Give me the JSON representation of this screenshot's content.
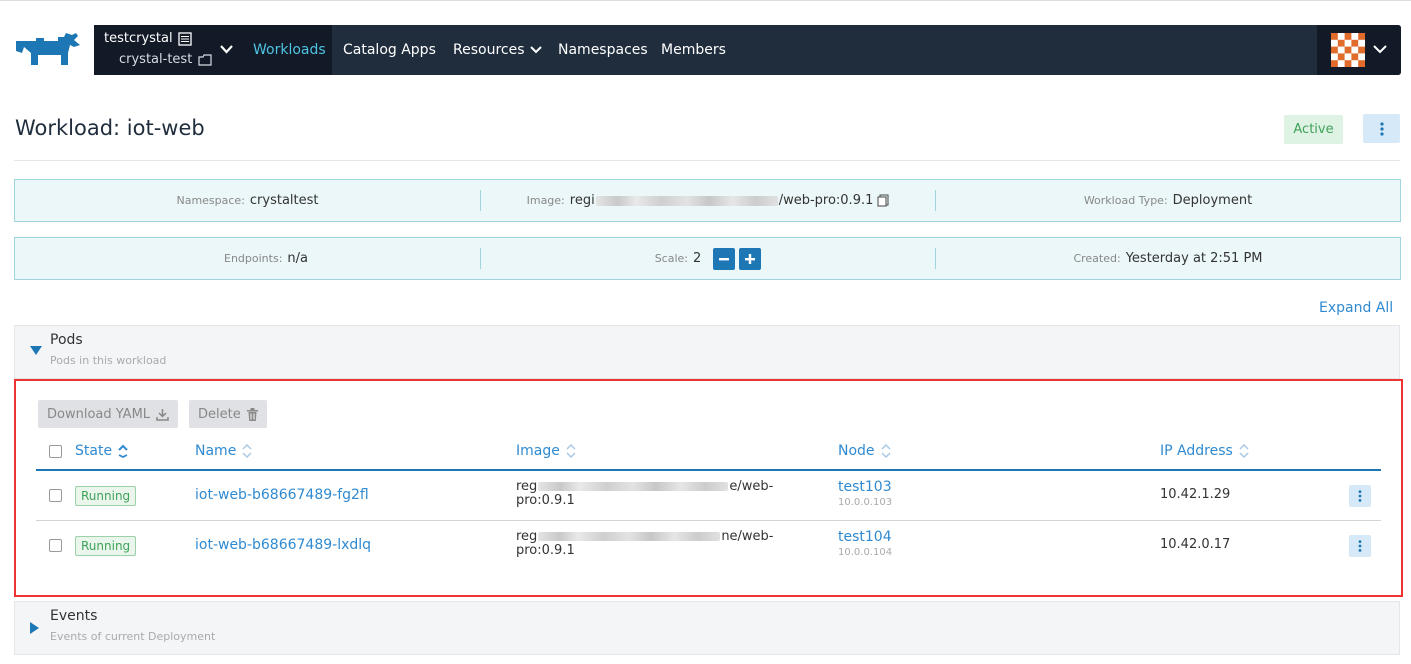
{
  "header": {
    "cluster": "testcrystal",
    "project": "crystal-test",
    "nav": [
      "Workloads",
      "Catalog Apps",
      "Resources",
      "Namespaces",
      "Members"
    ],
    "active_nav": "Workloads"
  },
  "page": {
    "title": "Workload: iot-web",
    "status": "Active"
  },
  "info": {
    "namespace_label": "Namespace:",
    "namespace": "crystaltest",
    "image_label": "Image:",
    "image_prefix": "regi",
    "image_suffix": "/web-pro:0.9.1",
    "type_label": "Workload Type:",
    "type": "Deployment",
    "endpoints_label": "Endpoints:",
    "endpoints": "n/a",
    "scale_label": "Scale:",
    "scale": "2",
    "created_label": "Created:",
    "created": "Yesterday at 2:51 PM"
  },
  "expand_all": "Expand All",
  "pods": {
    "title": "Pods",
    "subtitle": "Pods in this workload",
    "download_yaml": "Download YAML",
    "delete": "Delete",
    "columns": [
      "State",
      "Name",
      "Image",
      "Node",
      "IP Address"
    ],
    "rows": [
      {
        "state": "Running",
        "name": "iot-web-b68667489-fg2fl",
        "image_prefix": "reg",
        "image_mid": "e/web-",
        "image_line2": "pro:0.9.1",
        "node": "test103",
        "node_ip": "10.0.0.103",
        "ip": "10.42.1.29"
      },
      {
        "state": "Running",
        "name": "iot-web-b68667489-lxdlq",
        "image_prefix": "reg",
        "image_mid": "ne/web-",
        "image_line2": "pro:0.9.1",
        "node": "test104",
        "node_ip": "10.0.0.104",
        "ip": "10.42.0.17"
      }
    ]
  },
  "events": {
    "title": "Events",
    "subtitle": "Events of current Deployment"
  },
  "colors": {
    "navbar": "#1f2d3d",
    "accent": "#2f8ad1",
    "active": "#3fa25a",
    "highlight_border": "#ee3333"
  }
}
